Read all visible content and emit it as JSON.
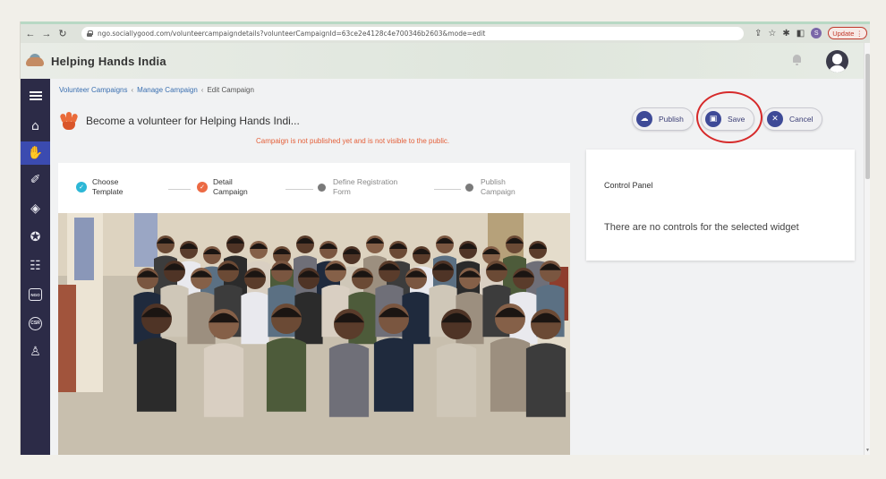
{
  "browser": {
    "url": "ngo.sociallygood.com/volunteercampaigndetails?volunteerCampaignId=63ce2e4128c4e700346b2603&mode=edit",
    "extension_letter": "S",
    "update_label": "Update"
  },
  "app": {
    "title": "Helping Hands India"
  },
  "breadcrumb": {
    "items": [
      "Volunteer Campaigns",
      "Manage Campaign",
      "Edit Campaign"
    ],
    "separator": "‹"
  },
  "campaign": {
    "title": "Become a volunteer for Helping Hands Indi...",
    "notice": "Campaign is not published yet and is not visible to the public."
  },
  "actions": {
    "publish": "Publish",
    "save": "Save",
    "cancel": "Cancel"
  },
  "steps": [
    {
      "line1": "Choose",
      "line2": "Template",
      "status": "done"
    },
    {
      "line1": "Detail",
      "line2": "Campaign",
      "status": "current"
    },
    {
      "line1": "Define Registration",
      "line2": "Form",
      "status": "pending"
    },
    {
      "line1": "Publish",
      "line2": "Campaign",
      "status": "pending"
    }
  ],
  "control_panel": {
    "title": "Control Panel",
    "message": "There are no controls for the selected widget"
  },
  "colors": {
    "sidebar": "#2c2b47",
    "accent": "#3e4a97",
    "notice": "#e4603a",
    "highlight": "#d62a2a"
  },
  "icons": {
    "sidebar": [
      "menu-icon",
      "home-icon",
      "volunteer-icon",
      "campaign-icon",
      "target-icon",
      "award-icon",
      "list-icon",
      "ngo-icon",
      "csr-icon",
      "people-icon"
    ]
  }
}
